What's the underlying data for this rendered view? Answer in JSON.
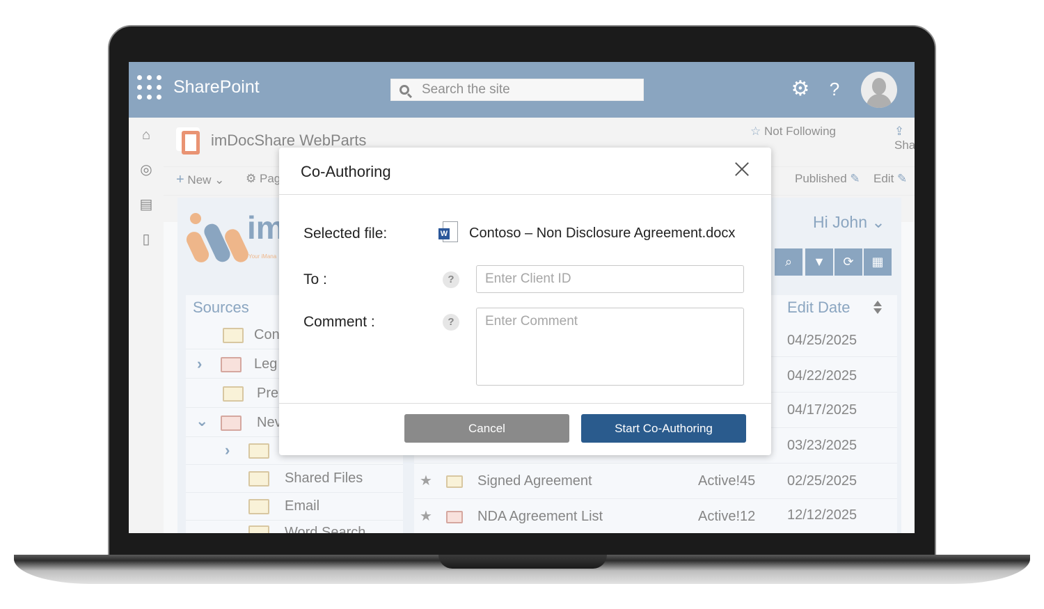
{
  "suite": {
    "app_name": "SharePoint",
    "search_placeholder": "Search the site"
  },
  "site": {
    "title": "imDocShare WebParts",
    "not_following": "Not Following",
    "share": "Share"
  },
  "commandbar": {
    "new": "New",
    "page": "Pag",
    "published": "Published",
    "edit": "Edit"
  },
  "webpart": {
    "logo_text": "im",
    "logo_tagline": "Your iMana",
    "greeting": "Hi John",
    "sources_header": "Sources",
    "edit_date_header": "Edit Date",
    "sources": [
      {
        "label": "Con"
      },
      {
        "label": "Leg"
      },
      {
        "label": "Pre"
      },
      {
        "label": "Nev"
      },
      {
        "label": ""
      },
      {
        "label": "Shared Files"
      },
      {
        "label": "Email"
      },
      {
        "label": "Word Search"
      }
    ],
    "rows": [
      {
        "name": "",
        "status": "",
        "date": "04/25/2025"
      },
      {
        "name": "",
        "status": "",
        "date": "04/22/2025"
      },
      {
        "name": "",
        "status": "",
        "date": "04/17/2025"
      },
      {
        "name": "",
        "status": "",
        "date": "03/23/2025"
      },
      {
        "name": "Signed Agreement",
        "status": "Active!45",
        "date": "02/25/2025"
      },
      {
        "name": "NDA Agreement List",
        "status": "Active!12",
        "date": "12/12/2025"
      }
    ]
  },
  "dialog": {
    "title": "Co-Authoring",
    "selected_file_label": "Selected file:",
    "selected_file_name": "Contoso – Non Disclosure Agreement.docx",
    "to_label": "To :",
    "to_placeholder": "Enter Client ID",
    "comment_label": "Comment :",
    "comment_placeholder": "Enter Comment",
    "help_glyph": "?",
    "cancel_label": "Cancel",
    "start_label": "Start Co-Authoring"
  },
  "colors": {
    "brand": "#2a5b8d",
    "cancel": "#8a8a8a"
  },
  "icons": [
    "waffle-icon",
    "search-icon",
    "gear-icon",
    "help-icon",
    "avatar",
    "home-icon",
    "globe-icon",
    "news-icon",
    "page-icon",
    "star-icon",
    "share-icon",
    "pencil-icon",
    "close-icon",
    "word-file-icon",
    "help-icon",
    "folder-icon",
    "chevron-right-icon",
    "chevron-down-icon",
    "filter-icon",
    "refresh-icon",
    "excel-icon",
    "sort-icon"
  ]
}
